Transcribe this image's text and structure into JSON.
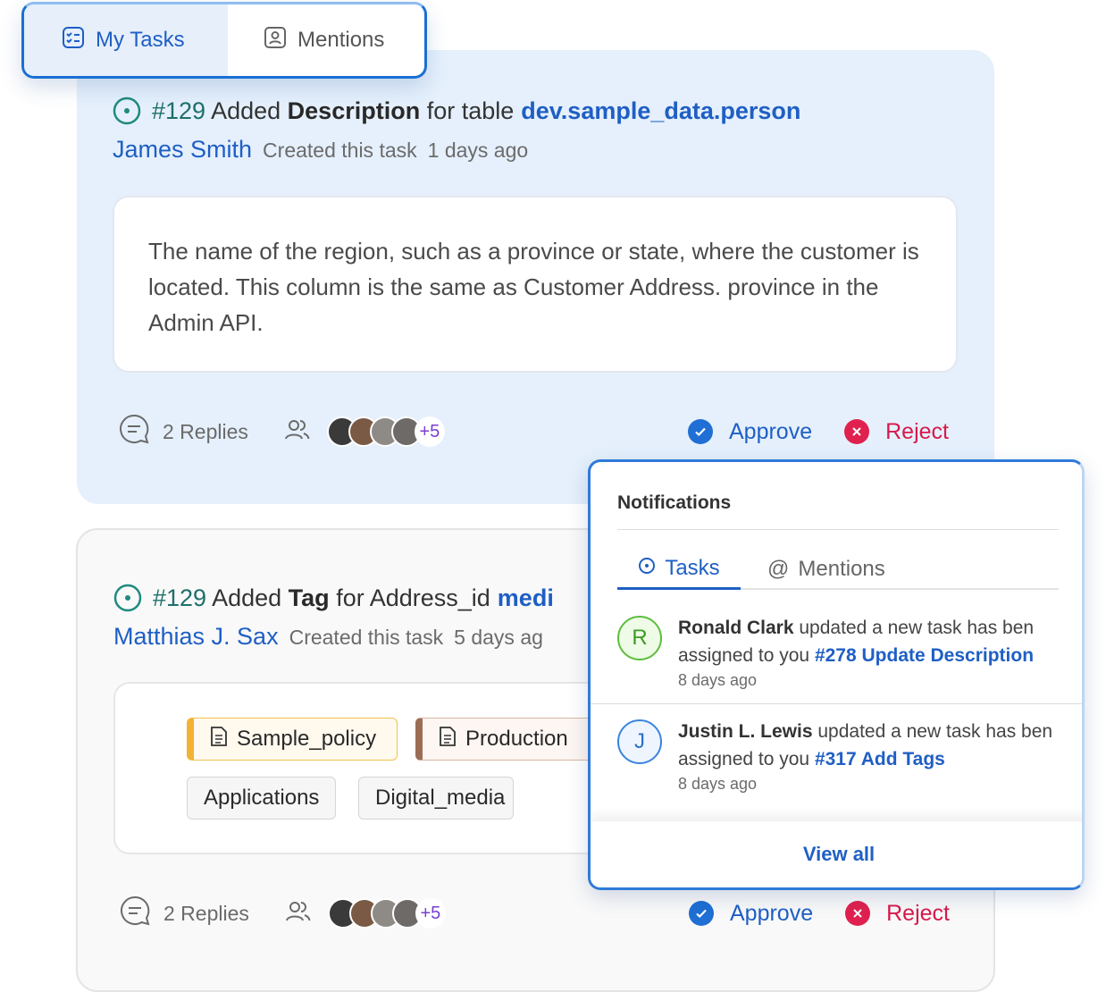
{
  "top_tabs": {
    "my_tasks": "My Tasks",
    "mentions": "Mentions"
  },
  "tasks": [
    {
      "id": "#129",
      "action_prefix": "Added",
      "action_bold": "Description",
      "action_suffix": "for table",
      "target": "dev.sample_data.person",
      "author": "James Smith",
      "created": "Created this task",
      "age": "1 days ago",
      "description": "The name of the region, such as a province or state, where the customer is located. This column is the same as Customer Address. province in the Admin API.",
      "replies": "2 Replies",
      "more_count": "+5",
      "approve": "Approve",
      "reject": "Reject"
    },
    {
      "id": "#129",
      "action_prefix": "Added",
      "action_bold": "Tag",
      "action_suffix": "for Address_id",
      "target": "medi",
      "author": "Matthias J. Sax",
      "created": "Created this task",
      "age": "5 days ag",
      "tags": [
        "Sample_policy",
        "Production",
        "Applications",
        "Digital_media"
      ],
      "replies": "2 Replies",
      "more_count": "+5",
      "approve": "Approve",
      "reject": "Reject"
    }
  ],
  "notifications": {
    "title": "Notifications",
    "tab_tasks": "Tasks",
    "tab_mentions": "Mentions",
    "items": [
      {
        "initial": "R",
        "name": "Ronald Clark",
        "text": "updated a new task has ben assigned to you",
        "link": "#278 Update Description",
        "time": "8 days ago"
      },
      {
        "initial": "J",
        "name": "Justin L. Lewis",
        "text": "updated a new task has ben assigned to you",
        "link": "#317 Add Tags",
        "time": "8 days ago"
      }
    ],
    "view_all": "View all"
  },
  "colors": {
    "accent_blue": "#1f5fc4",
    "status_teal": "#1f6f6a",
    "reject_red": "#d71a4b",
    "card_bg": "#e5f0fc"
  }
}
